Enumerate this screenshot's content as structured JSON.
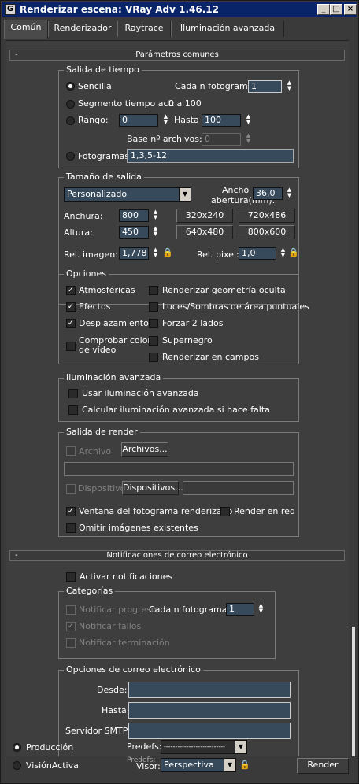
{
  "window": {
    "title": "Renderizar escena: VRay Adv 1.46.12",
    "icon": "3ds-max-icon",
    "min": "_",
    "max": "□",
    "close": "×"
  },
  "tabs": [
    "Común",
    "Renderizador",
    "Raytrace",
    "Iluminación avanzada"
  ],
  "common": {
    "header_min": "-",
    "header": "Parámetros comunes",
    "time_output": {
      "legend": "Salida de tiempo",
      "single": "Sencilla",
      "every_nth": "Cada n fotogramas:",
      "every_nth_value": "1",
      "active_segment": "Segmento tiempo act:",
      "active_segment_range": "0 a 100",
      "range": "Rango:",
      "range_from": "0",
      "to": "Hasta",
      "range_to": "100",
      "file_base": "Base nº archivos:",
      "file_base_value": "0",
      "frames": "Fotogramas:",
      "frames_value": "1,3,5-12"
    },
    "output_size": {
      "legend": "Tamaño de salida",
      "preset": "Personalizado",
      "aperture_label_1": "Ancho",
      "aperture_label_2": "abertura(mm):",
      "aperture_value": "36,0",
      "width": "Anchura:",
      "width_value": "800",
      "height": "Altura:",
      "height_value": "450",
      "presets": [
        "320x240",
        "720x486",
        "640x480",
        "800x600"
      ],
      "image_aspect": "Rel. imagen:",
      "image_aspect_value": "1,778",
      "pixel_aspect": "Rel. pixel:",
      "pixel_aspect_value": "1,0"
    },
    "options": {
      "legend": "Opciones",
      "atmospherics": "Atmosféricas",
      "effects": "Efectos",
      "displacement": "Desplazamiento",
      "video_color_1": "Comprobar color",
      "video_color_2": "de vídeo",
      "hidden_geometry": "Renderizar geometría oculta",
      "area_lights": "Luces/Sombras de área puntuales",
      "force_2sided": "Forzar 2 lados",
      "super_black": "Supernegro",
      "fields": "Renderizar en campos"
    },
    "advanced_lighting": {
      "legend": "Iluminación avanzada",
      "use": "Usar iluminación avanzada",
      "compute": "Calcular iluminación avanzada si hace falta"
    },
    "render_output": {
      "legend": "Salida de render",
      "file": "Archivo",
      "files_btn": "Archivos...",
      "device": "Dispositivo",
      "devices_btn": "Dispositivos...",
      "frame_window": "Ventana del fotograma renderizado",
      "net_render": "Render en red",
      "skip_existing": "Omitir imágenes existentes"
    }
  },
  "email": {
    "header_min": "-",
    "header": "Notificaciones de correo electrónico",
    "enable": "Activar notificaciones",
    "categories": {
      "legend": "Categorías",
      "progress": "Notificar progreso",
      "every_nth": "Cada n fotogramas:",
      "every_nth_value": "1",
      "failures": "Notificar fallos",
      "completion": "Notificar terminación"
    },
    "options": {
      "legend": "Opciones de correo electrónico",
      "from": "Desde:",
      "to": "Hasta:",
      "smtp": "Servidor SMTP:"
    }
  },
  "bottom": {
    "production": "Producción",
    "activeshade": "VisiónActiva",
    "preset_label": "Predefs:",
    "preset_value": "---------------------------",
    "preset_ghost": "Predefs:",
    "viewport_label": "Visor:",
    "viewport_value": "Perspectiva",
    "render": "Render"
  }
}
